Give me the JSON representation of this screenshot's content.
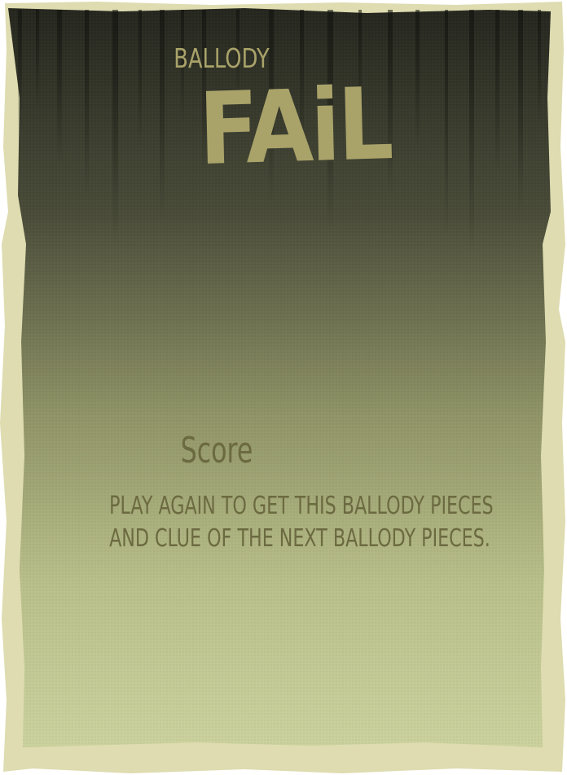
{
  "screen": {
    "kicker": "BALLODY",
    "title": "FAiL",
    "score_label": "Score",
    "message_lines": [
      "PLAY AGAIN TO GET THIS BALLODY PIECES",
      "AND CLUE OF THE NEXT BALLODY PIECES."
    ]
  },
  "colors": {
    "top": "#2b2d24",
    "bottom": "#c9cf9a",
    "border": "#dedcb0",
    "title": "#a9a36a",
    "text": "#6b6a40"
  }
}
